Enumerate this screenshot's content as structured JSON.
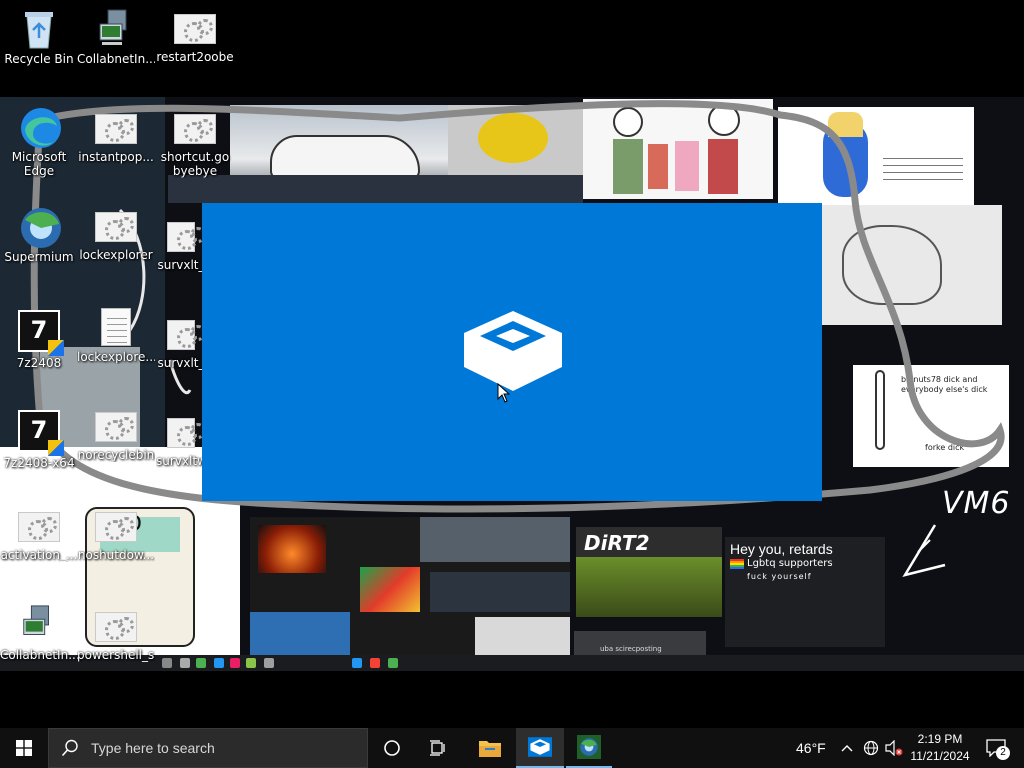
{
  "desktop_icons": [
    {
      "label": "Recycle Bin"
    },
    {
      "label": "CollabnetIn..."
    },
    {
      "label": "restart2oobe"
    },
    {
      "label": "Microsoft Edge"
    },
    {
      "label": "instantpop..."
    },
    {
      "label": "shortcut.go byebye"
    },
    {
      "label": "Supermium"
    },
    {
      "label": "lockexplorer"
    },
    {
      "label": "survxlt_"
    },
    {
      "label": "7z2408"
    },
    {
      "label": "lockexplore..."
    },
    {
      "label": "survxlt_"
    },
    {
      "label": "7z2408-x64"
    },
    {
      "label": "norecyclebin"
    },
    {
      "label": "survxltw"
    },
    {
      "label": "activation_..."
    },
    {
      "label": "noshutdow..."
    },
    {
      "label": "CollabnetIn..."
    },
    {
      "label": "powershell_s..."
    }
  ],
  "wallpaper": {
    "vm_label": "VM6",
    "banner_title": "Hey you, retards",
    "banner_sub": "Lgbtq supporters",
    "sketch_caption": "fuck yourself",
    "dirt_logo": "DiRT2",
    "sketch_note": "bignuts78 dick and everybody else's dick",
    "sketch_note2": "forke dick",
    "chat_text": "uba scirecposting"
  },
  "taskbar": {
    "search_placeholder": "Type here to search",
    "weather": "46°F",
    "time": "2:19 PM",
    "date": "11/21/2024",
    "notification_count": "2"
  },
  "colors": {
    "splash_blue": "#0078d7",
    "taskbar_bg": "#101010",
    "scribble_gray": "#8a8a8a"
  }
}
